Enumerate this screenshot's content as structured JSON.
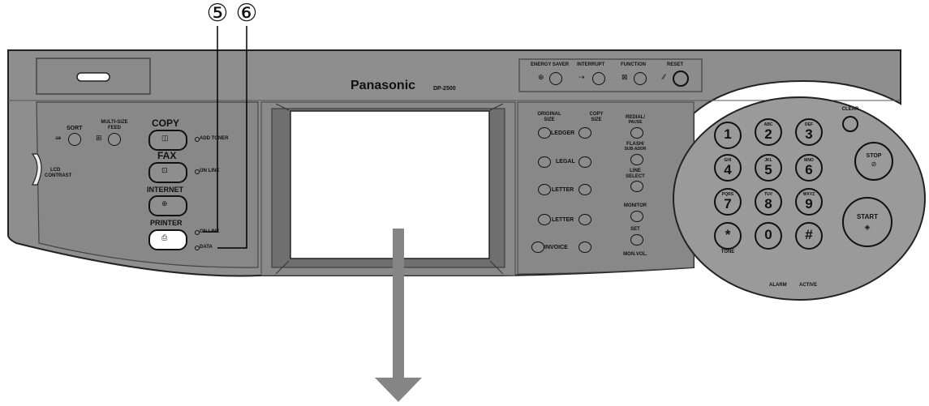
{
  "callouts": [
    "⑤",
    "⑥"
  ],
  "brand": {
    "name": "Panasonic",
    "model": "DP-2500"
  },
  "top_buttons": [
    {
      "label": "ENERGY SAVER",
      "icon": "energy-saver-icon"
    },
    {
      "label": "INTERRUPT",
      "icon": "interrupt-icon"
    },
    {
      "label": "FUNCTION",
      "icon": "function-icon"
    },
    {
      "label": "RESET",
      "icon": "reset-icon"
    }
  ],
  "left_panel": {
    "sort": "SORT",
    "multi_size_feed": [
      "MULTI-SIZE",
      "FEED"
    ],
    "lcd_contrast": [
      "LCD",
      "CONTRAST"
    ],
    "mode_buttons": [
      "COPY",
      "FAX",
      "INTERNET",
      "PRINTER"
    ],
    "indicators": [
      "ADD TONER",
      "ON LINE",
      "ON LINE",
      "DATA"
    ]
  },
  "one_touch": {
    "original_size": [
      "ORIGINAL",
      "SIZE"
    ],
    "copy_size": [
      "COPY",
      "SIZE"
    ],
    "paper_sizes": [
      "LEDGER",
      "LEGAL",
      "LETTER",
      "LETTER",
      "INVOICE"
    ],
    "function_keys": [
      [
        "REDIAL/",
        "PAUSE"
      ],
      [
        "FLASH/",
        "SUB-ADDR"
      ],
      [
        "LINE",
        "SELECT"
      ],
      [
        "MONITOR"
      ],
      [
        "SET"
      ]
    ],
    "mon_vol": "MON.VOL."
  },
  "keypad": {
    "keys": [
      {
        "digit": "1",
        "letters": ""
      },
      {
        "digit": "2",
        "letters": "ABC"
      },
      {
        "digit": "3",
        "letters": "DEF"
      },
      {
        "digit": "4",
        "letters": "GHI"
      },
      {
        "digit": "5",
        "letters": "JKL"
      },
      {
        "digit": "6",
        "letters": "MNO"
      },
      {
        "digit": "7",
        "letters": "PQRS"
      },
      {
        "digit": "8",
        "letters": "TUV"
      },
      {
        "digit": "9",
        "letters": "WXYZ"
      },
      {
        "digit": "*",
        "letters": ""
      },
      {
        "digit": "0",
        "letters": ""
      },
      {
        "digit": "#",
        "letters": ""
      }
    ],
    "tone": "TONE",
    "clear": "CLEAR",
    "stop": "STOP",
    "start": "START",
    "alarm": "ALARM",
    "active": "ACTIVE"
  },
  "colors": {
    "panel": "#8e8e8e",
    "panel_dark": "#6f6f6f",
    "screen": "#ffffff",
    "arrow": "#858585"
  }
}
